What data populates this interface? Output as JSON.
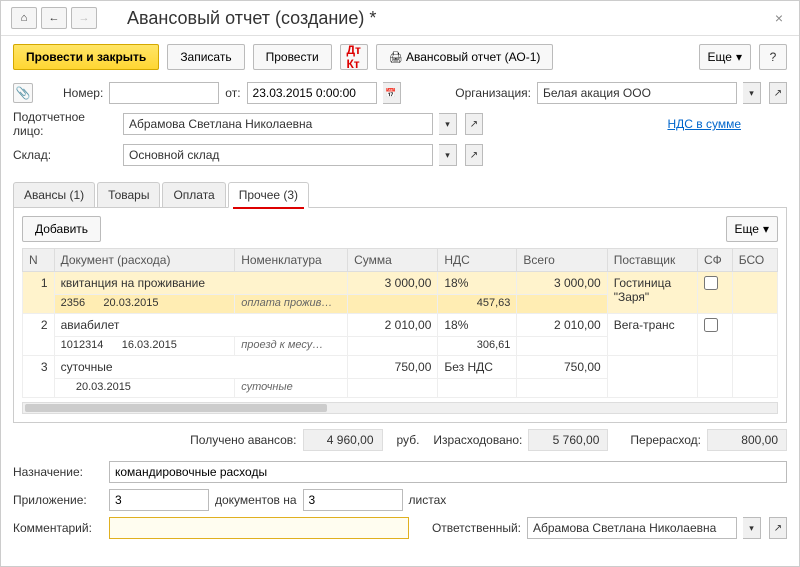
{
  "title": "Авансовый отчет (создание) *",
  "toolbar": {
    "post_close": "Провести и закрыть",
    "save": "Записать",
    "post": "Провести",
    "print_report": "Авансовый отчет (АО-1)",
    "more": "Еще"
  },
  "form": {
    "number_label": "Номер:",
    "number": "",
    "date_label": "от:",
    "date": "23.03.2015 0:00:00",
    "org_label": "Организация:",
    "org": "Белая акация ООО",
    "person_label": "Подотчетное лицо:",
    "person": "Абрамова Светлана Николаевна",
    "vat_link": "НДС в сумме",
    "warehouse_label": "Склад:",
    "warehouse": "Основной склад"
  },
  "tabs": {
    "t1": "Авансы (1)",
    "t2": "Товары",
    "t3": "Оплата",
    "t4": "Прочее (3)"
  },
  "tab_toolbar": {
    "add": "Добавить",
    "more": "Еще"
  },
  "columns": {
    "n": "N",
    "doc": "Документ (расхода)",
    "nomen": "Номенклатура",
    "sum": "Сумма",
    "vat": "НДС",
    "total": "Всего",
    "supplier": "Поставщик",
    "sf": "СФ",
    "bso": "БСО"
  },
  "rows": [
    {
      "n": "1",
      "doc": "квитанция на проживание",
      "doc_num": "2356",
      "doc_date": "20.03.2015",
      "nomen": "оплата прожив…",
      "sum": "3 000,00",
      "vat_rate": "18%",
      "vat_amount": "457,63",
      "total": "3 000,00",
      "supplier": "Гостиница \"Заря\""
    },
    {
      "n": "2",
      "doc": "авиабилет",
      "doc_num": "1012314",
      "doc_date": "16.03.2015",
      "nomen": "проезд к месу…",
      "sum": "2 010,00",
      "vat_rate": "18%",
      "vat_amount": "306,61",
      "total": "2 010,00",
      "supplier": "Вега-транс"
    },
    {
      "n": "3",
      "doc": "суточные",
      "doc_num": "",
      "doc_date": "20.03.2015",
      "nomen": "суточные",
      "sum": "750,00",
      "vat_rate": "Без НДС",
      "vat_amount": "",
      "total": "750,00",
      "supplier": ""
    }
  ],
  "totals": {
    "received_label": "Получено авансов:",
    "received": "4 960,00",
    "currency": "руб.",
    "spent_label": "Израсходовано:",
    "spent": "5 760,00",
    "overrun_label": "Перерасход:",
    "overrun": "800,00"
  },
  "bottom": {
    "purpose_label": "Назначение:",
    "purpose": "командировочные расходы",
    "attach_label": "Приложение:",
    "attach_docs": "3",
    "attach_docs_suffix": "документов на",
    "attach_sheets": "3",
    "attach_sheets_suffix": "листах",
    "comment_label": "Комментарий:",
    "comment": "",
    "responsible_label": "Ответственный:",
    "responsible": "Абрамова Светлана Николаевна"
  }
}
